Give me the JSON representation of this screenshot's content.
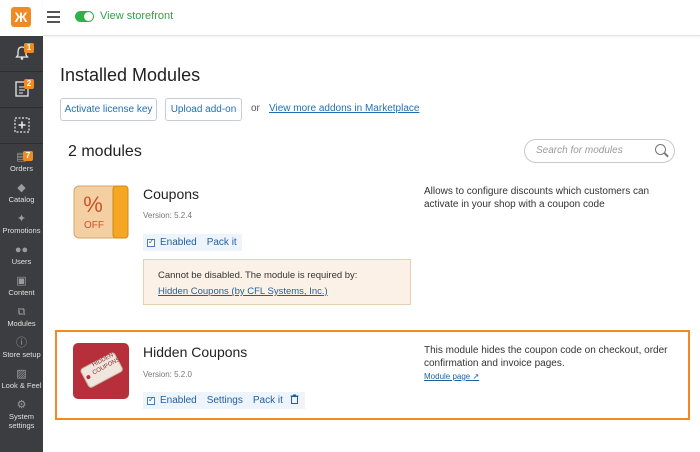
{
  "sidebar": {
    "logo": "Ж",
    "top_icons": [
      {
        "name": "bell-icon",
        "badge": "1"
      },
      {
        "name": "orders-doc-icon",
        "badge": "2"
      },
      {
        "name": "add-icon",
        "badge": ""
      }
    ],
    "items": [
      {
        "label": "Orders",
        "icon": "orders-icon",
        "badge": "7"
      },
      {
        "label": "Catalog",
        "icon": "catalog-icon"
      },
      {
        "label": "Promotions",
        "icon": "promotions-icon"
      },
      {
        "label": "Users",
        "icon": "users-icon"
      },
      {
        "label": "Content",
        "icon": "content-icon"
      },
      {
        "label": "Modules",
        "icon": "modules-icon"
      },
      {
        "label": "Store setup",
        "icon": "store-setup-icon"
      },
      {
        "label": "Look & Feel",
        "icon": "look-feel-icon"
      },
      {
        "label_line1": "System",
        "label_line2": "settings",
        "icon": "system-settings-icon"
      }
    ]
  },
  "topbar": {
    "storefront_label": "View storefront",
    "storefront_enabled": true
  },
  "main": {
    "title": "Installed Modules",
    "buttons": {
      "activate": "Activate license key",
      "upload": "Upload add-on"
    },
    "or_text": "or",
    "marketplace_link": "View more addons in Marketplace",
    "count_text": "2 modules",
    "search_placeholder": "Search for modules"
  },
  "modules": [
    {
      "name": "Coupons",
      "version": "Version: 5.2.4",
      "icon_text": "OFF",
      "enabled_label": "Enabled",
      "pack_label": "Pack it",
      "description_line1": "Allows to configure discounts which customers can",
      "description_line2": "activate in your shop with a coupon code",
      "warning_text": "Cannot be disabled. The module is required by:",
      "warning_link": "Hidden Coupons (by CFL Systems, Inc.)"
    },
    {
      "name": "Hidden Coupons",
      "version": "Version: 5.2.0",
      "icon_text": "HIDDEN COUPONS",
      "enabled_label": "Enabled",
      "settings_label": "Settings",
      "pack_label": "Pack it",
      "description_line1": "This module hides the coupon code on checkout, order",
      "description_line2": "confirmation and invoice pages.",
      "module_page_link": "Module page"
    }
  ],
  "colors": {
    "accent": "#f08a24",
    "link": "#1f6fb5",
    "sidebar_bg": "#3b3d40",
    "toggle_on": "#2fb24b"
  }
}
